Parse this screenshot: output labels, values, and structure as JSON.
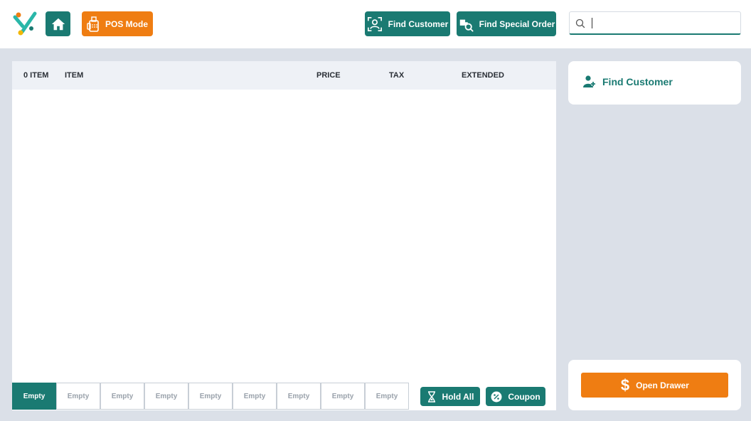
{
  "colors": {
    "teal": "#1a7a72",
    "orange": "#ef7d12",
    "background": "#dbe0e8"
  },
  "header": {
    "logo_icon": "brand-logo-icon",
    "home_icon": "home-icon",
    "pos_mode_label": "POS Mode",
    "find_customer_label": "Find Customer",
    "find_special_order_label": "Find Special Order",
    "search": {
      "value": "",
      "placeholder": ""
    }
  },
  "table": {
    "headers": {
      "count": "0 ITEM",
      "item": "ITEM",
      "price": "PRICE",
      "tax": "TAX",
      "extended": "EXTENDED"
    },
    "rows": []
  },
  "holds": [
    {
      "label": "Empty",
      "active": true
    },
    {
      "label": "Empty",
      "active": false
    },
    {
      "label": "Empty",
      "active": false
    },
    {
      "label": "Empty",
      "active": false
    },
    {
      "label": "Empty",
      "active": false
    },
    {
      "label": "Empty",
      "active": false
    },
    {
      "label": "Empty",
      "active": false
    },
    {
      "label": "Empty",
      "active": false
    },
    {
      "label": "Empty",
      "active": false
    }
  ],
  "actions": {
    "hold_all_label": "Hold All",
    "coupon_label": "Coupon"
  },
  "right_panel": {
    "find_customer_label": "Find Customer",
    "open_drawer_label": "Open Drawer"
  }
}
